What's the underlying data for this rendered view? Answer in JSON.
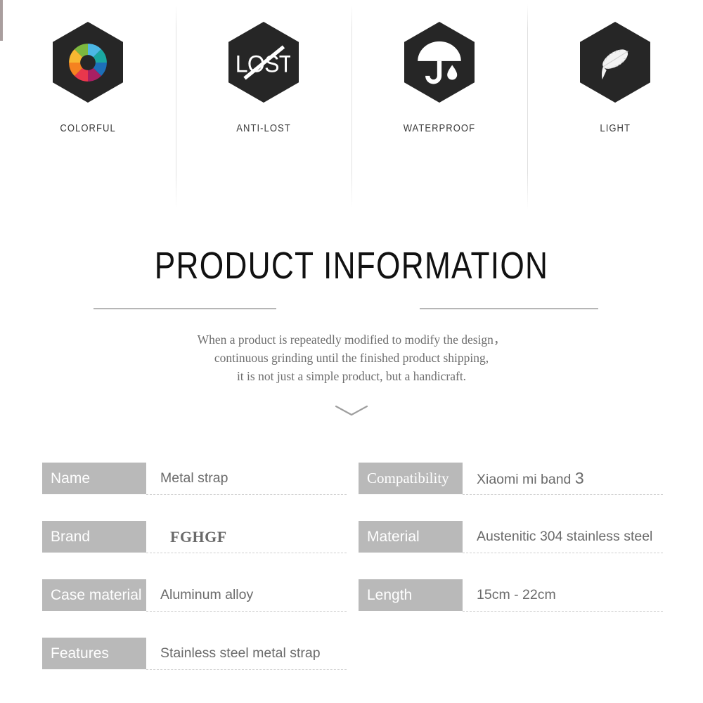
{
  "features": [
    {
      "icon": "color-wheel-icon",
      "label": "COLORFUL"
    },
    {
      "icon": "anti-lost-icon",
      "label": "ANTI-LOST"
    },
    {
      "icon": "umbrella-waterproof-icon",
      "label": "WATERPROOF"
    },
    {
      "icon": "feather-light-icon",
      "label": "LIGHT"
    }
  ],
  "section": {
    "title": "PRODUCT INFORMATION",
    "description_lines": [
      "When a product is repeatedly modified to modify the design，",
      "continuous grinding until the finished product shipping,",
      "it is not just a simple product, but a handicraft."
    ],
    "chevron_icon": "chevron-down-icon"
  },
  "specs": {
    "left_column": [
      {
        "label": "Name",
        "value": "Metal strap"
      },
      {
        "label": "Brand",
        "value": "FGHGF"
      },
      {
        "label": "Case material",
        "value": "Aluminum alloy"
      },
      {
        "label": "Features",
        "value": "Stainless steel metal strap"
      }
    ],
    "right_column": [
      {
        "label": "Compatibility",
        "value": "Xiaomi mi band ",
        "value_num": "3"
      },
      {
        "label": "Material",
        "value": "Austenitic 304 stainless steel"
      },
      {
        "label": "Length",
        "value": "15cm - 22cm"
      }
    ]
  },
  "colors": {
    "hex_badge": "#262626",
    "label_box": "#b9b9b9",
    "value_text": "#6b6b6b",
    "rule": "#b6b6b6",
    "wheel_segments": [
      "#4cb7e5",
      "#1aa7a0",
      "#1d6fb8",
      "#a81f63",
      "#d5356a",
      "#ef4136",
      "#f58220",
      "#f7b731",
      "#7cb83f"
    ]
  }
}
